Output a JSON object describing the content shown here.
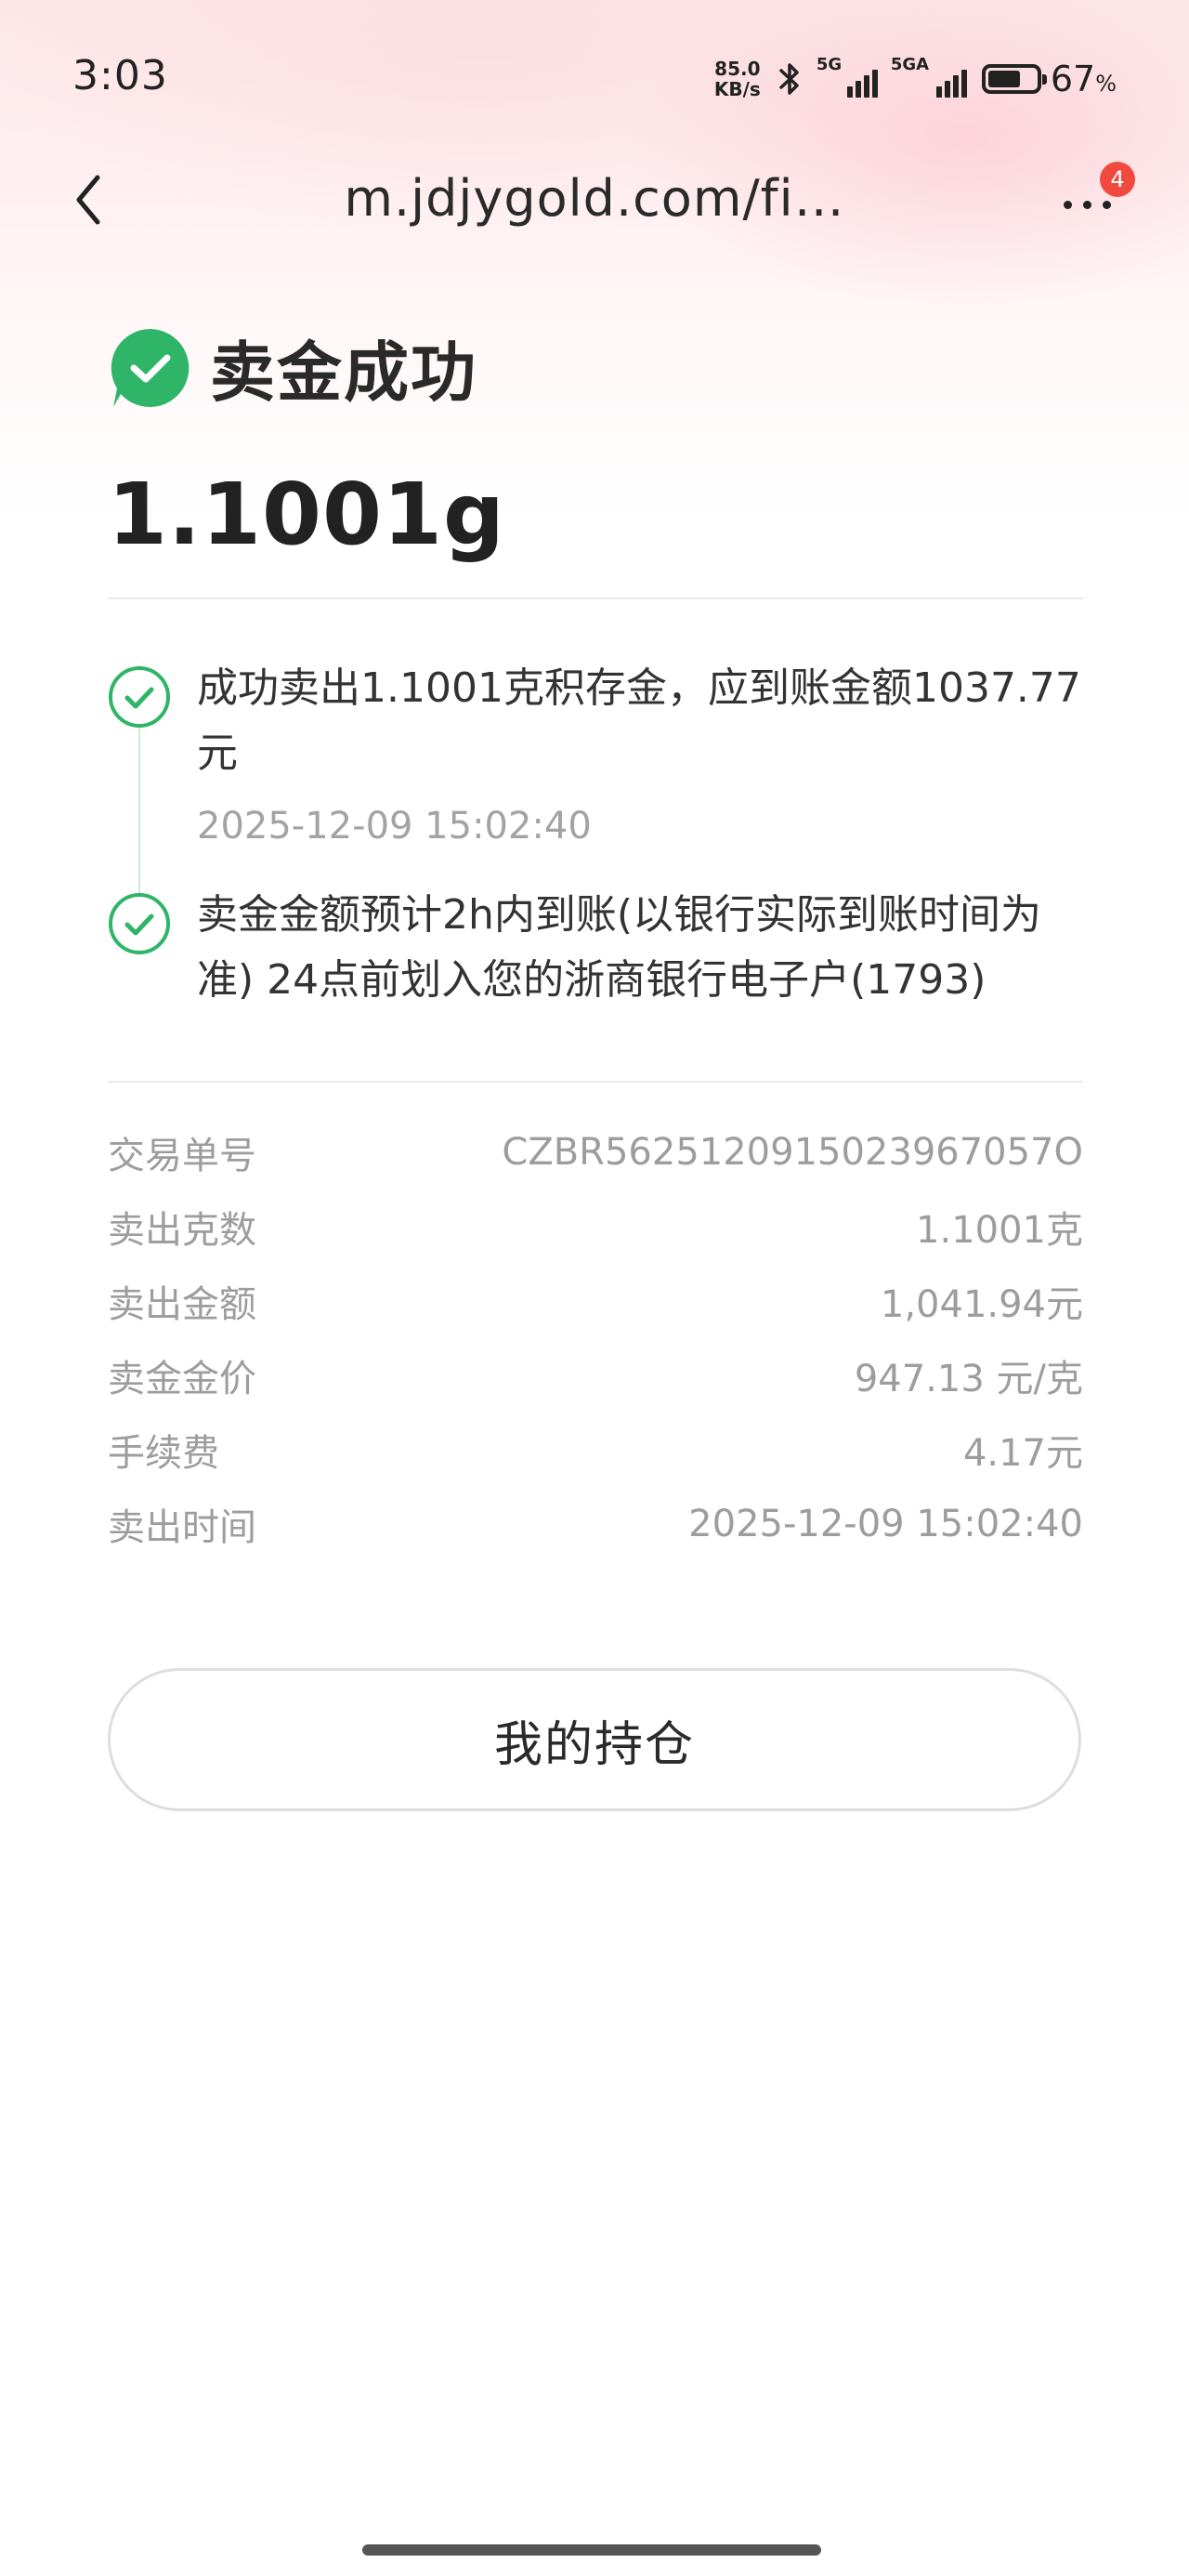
{
  "status_bar": {
    "time": "3:03",
    "net_speed_value": "85.0",
    "net_speed_unit": "KB/s",
    "sim1_label": "5G",
    "sim2_label": "5GA",
    "battery_percent": "67",
    "battery_percent_sign": "%",
    "battery_level_fraction": 0.67
  },
  "nav": {
    "url": "m.jdjygold.com/fi…",
    "notification_count": "4"
  },
  "result": {
    "title": "卖金成功",
    "amount": "1.1001g",
    "status_color": "#2fb568"
  },
  "timeline": [
    {
      "text": "成功卖出1.1001克积存金，应到账金额1037.77元",
      "time": "2025-12-09 15:02:40"
    },
    {
      "text": "卖金金额预计2h内到账(以银行实际到账时间为准) 24点前划入您的浙商银行电子户(1793)"
    }
  ],
  "details": [
    {
      "label": "交易单号",
      "value": "CZBR5625120915023967057O"
    },
    {
      "label": "卖出克数",
      "value": "1.1001克"
    },
    {
      "label": "卖出金额",
      "value": "1,041.94元"
    },
    {
      "label": "卖金金价",
      "value": "947.13 元/克"
    },
    {
      "label": "手续费",
      "value": "4.17元"
    },
    {
      "label": "卖出时间",
      "value": "2025-12-09 15:02:40"
    }
  ],
  "actions": {
    "holdings_button": "我的持仓"
  },
  "icons": {
    "back": "chevron-left-icon",
    "more": "more-dots-icon",
    "success": "check-circle-icon",
    "bluetooth": "bluetooth-icon"
  }
}
